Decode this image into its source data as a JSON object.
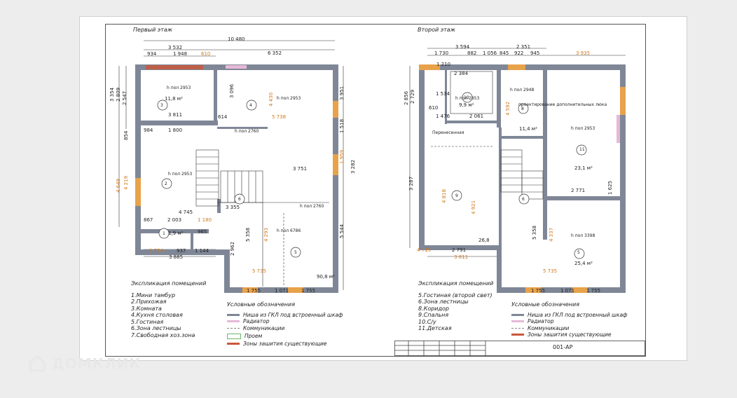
{
  "colors": {
    "wall": "#7f8797",
    "accent": "#e8a24a",
    "pink": "#e6b9d8",
    "green": "#6cb86c",
    "hatch": "#c9583a"
  },
  "floor1": {
    "title": "Первый этаж",
    "dims_top": {
      "total": "10 480",
      "left": "3 532",
      "right": "6 352",
      "a": "934",
      "b": "1 948",
      "c": "610"
    },
    "rooms": [
      {
        "num": "3",
        "label": "h пол 2953",
        "area": "11,8 м²"
      },
      {
        "num": "4",
        "label": "h пол 2953"
      },
      {
        "num": "2",
        "label": "h пол 2953"
      },
      {
        "num": "1",
        "area": "1,9 м²"
      },
      {
        "num": "6",
        "label": "h пол 2760"
      },
      {
        "num": "5",
        "label": "h пол 6786",
        "area": "90,8 м²"
      }
    ],
    "misc_dims": [
      "3 811",
      "3 096",
      "614",
      "5 738",
      "984",
      "1 800",
      "3 751",
      "4 745",
      "3 355",
      "867",
      "2 003",
      "1 180",
      "965",
      "1 754",
      "937",
      "1 144",
      "3 885",
      "5 358",
      "2 962",
      "5 735",
      "1 755",
      "1 071",
      "1 755",
      "3 951",
      "1 518",
      "1 959",
      "5 544",
      "4 430",
      "4 293",
      "3 354",
      "2 809",
      "2 547",
      "854",
      "4 649",
      "4 219",
      "3 282",
      "h пол 2760"
    ],
    "explication_title": "Экспликация помещений",
    "explication": [
      "1.Мини тамбур",
      "2.Прихожая",
      "3.Комната",
      "4.Кухня столовая",
      "5.Гостиная",
      "6.Зона лестницы",
      "7.Свободная хоз.зона"
    ],
    "legend_title": "Условные обозначения",
    "legend": [
      "Ниша из ГКЛ под встроенный шкаф",
      "Радиатор",
      "Коммуникации",
      "Проем",
      "Зоны зашития существующие"
    ]
  },
  "floor2": {
    "title": "Второй этаж",
    "dims_top": {
      "a": "3 594",
      "b": "2 351",
      "c": "1 730",
      "d": "882",
      "e": "1 056",
      "f": "845",
      "g": "922",
      "h": "945",
      "i": "3 935"
    },
    "rooms": [
      {
        "num": "10",
        "label": "h пол 2853",
        "area": "9,9 м²"
      },
      {
        "num": "8",
        "label": "h пол 2948",
        "area": "11,4 м²"
      },
      {
        "num": "11",
        "label": "h пол 2953",
        "area": "23,1 м²"
      },
      {
        "num": "9"
      },
      {
        "num": "6"
      },
      {
        "num": "5",
        "label": "h пол 3398",
        "area": "25,4 м²"
      }
    ],
    "notes": [
      "проектирование дополнительных люка",
      "1 210",
      "2 384",
      "1 534",
      "1 476",
      "2 061",
      "610",
      "2 856",
      "2 729",
      "4 592",
      "3 287",
      "4 818",
      "4 921",
      "1 625",
      "2 771",
      "2 791",
      "3 811",
      "4 715",
      "26,8",
      "5 358",
      "4 337",
      "5 735",
      "1 755",
      "1 071",
      "1 755",
      "Перенесенная",
      "5 735"
    ],
    "explication_title": "Экспликация помещений",
    "explication": [
      "5.Гостиная (второй свет)",
      "6.Зона лестницы",
      "8.Коридор",
      "9.Спальня",
      "10.С/у",
      "11.Детская"
    ],
    "legend_title": "Условные обозначения",
    "legend": [
      "Ниша из ГКЛ под встроенный шкаф",
      "Радиатор",
      "Коммуникации",
      "Зоны зашития существующие"
    ]
  },
  "stamp": {
    "code": "001-АР"
  },
  "watermark": {
    "text": "ДОМКЛИК"
  }
}
